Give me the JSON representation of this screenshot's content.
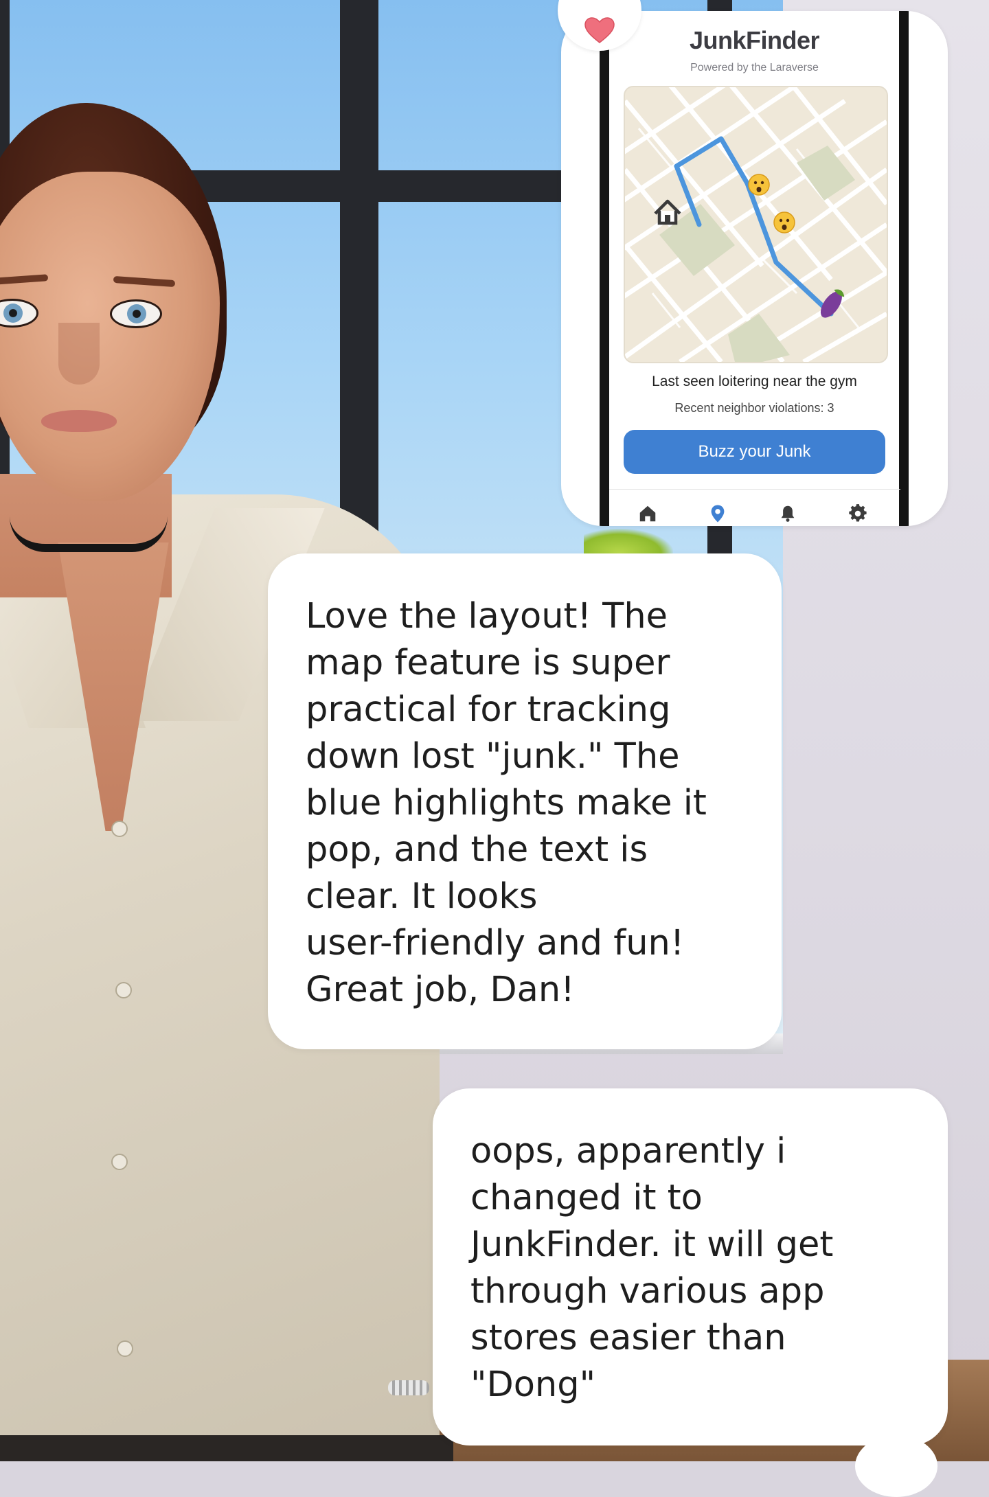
{
  "app": {
    "title": "JunkFinder",
    "subtitle": "Powered by the Laraverse",
    "status": "Last seen loitering near the gym",
    "violations": "Recent neighbor violations: 3",
    "action_button": "Buzz your Junk",
    "accent_color": "#3f80d2",
    "map_markers": [
      "house-icon",
      "worried-face-emoji",
      "worried-face-emoji",
      "eggplant-emoji"
    ],
    "tabs": [
      {
        "name": "home-icon",
        "active": false
      },
      {
        "name": "location-pin-icon",
        "active": true
      },
      {
        "name": "bell-icon",
        "active": false
      },
      {
        "name": "gear-icon",
        "active": false
      }
    ]
  },
  "reaction": {
    "icon": "heart-icon"
  },
  "messages": [
    {
      "sender": "ai",
      "text": "Love the layout! The\nmap feature is super\npractical for tracking\ndown lost \"junk.\" The\nblue highlights make it\npop, and the text is\nclear. It looks\nuser-friendly and fun!\nGreat job, Dan!"
    },
    {
      "sender": "user",
      "text": "oops, apparently i\nchanged it to\nJunkFinder.  it will get\nthrough various app\nstores easier than\n\"Dong\""
    }
  ]
}
